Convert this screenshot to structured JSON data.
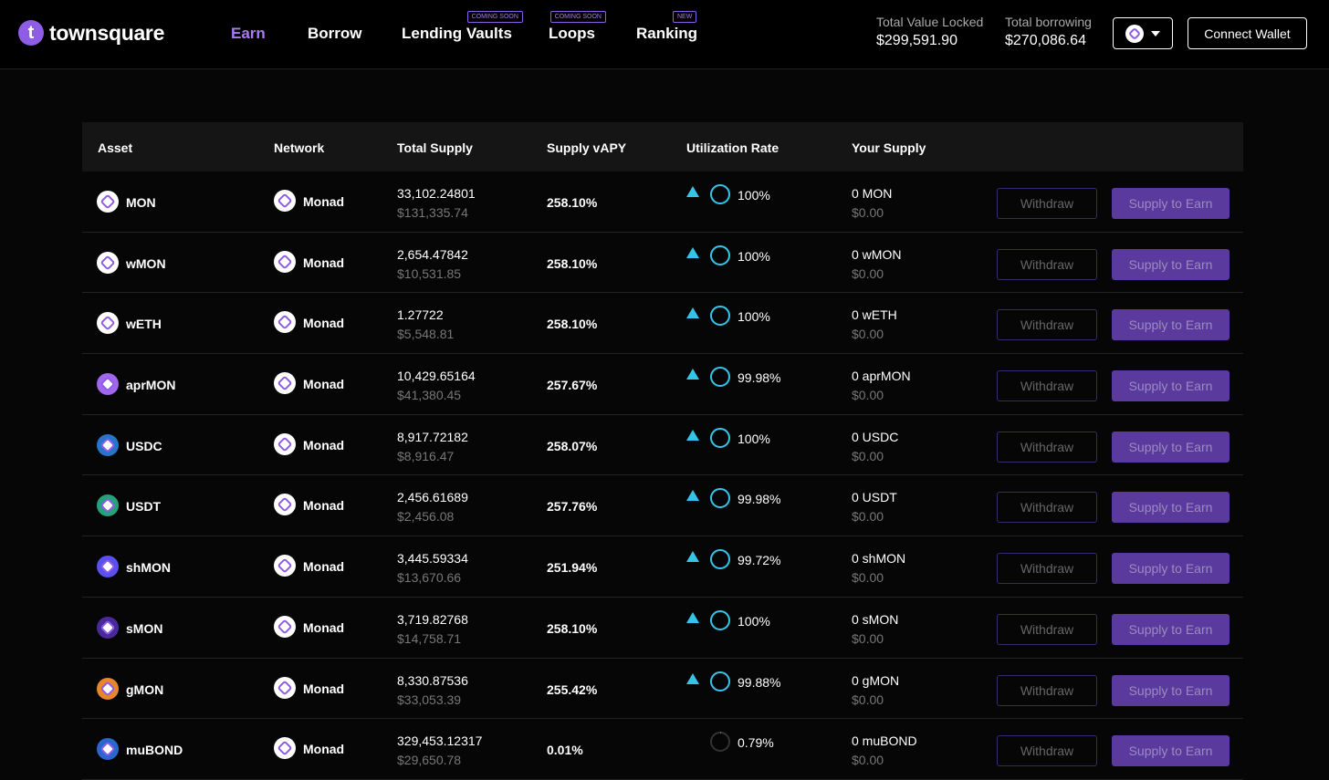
{
  "header": {
    "logo": "townsquare",
    "nav": [
      {
        "label": "Earn",
        "badge": null
      },
      {
        "label": "Borrow",
        "badge": null
      },
      {
        "label": "Lending Vaults",
        "badge": "COMING SOON"
      },
      {
        "label": "Loops",
        "badge": "COMING SOON"
      },
      {
        "label": "Ranking",
        "badge": "NEW"
      }
    ],
    "tvl_label": "Total Value Locked",
    "tvl": "$299,591.90",
    "borrow_label": "Total borrowing",
    "borrow": "$270,086.64",
    "connect": "Connect Wallet"
  },
  "table": {
    "columns": [
      "Asset",
      "Network",
      "Total Supply",
      "Supply vAPY",
      "Utilization Rate",
      "Your Supply"
    ],
    "withdraw_label": "Withdraw",
    "supply_label": "Supply to Earn",
    "rows": [
      {
        "asset": "MON",
        "icon_color": "#ffffff",
        "network": "Monad",
        "supply": "33,102.24801",
        "supply_usd": "$131,335.74",
        "apy": "258.10%",
        "util": "100%",
        "util_value": 100,
        "warn": true,
        "your": "0 MON",
        "your_usd": "$0.00"
      },
      {
        "asset": "wMON",
        "icon_color": "#ffffff",
        "network": "Monad",
        "supply": "2,654.47842",
        "supply_usd": "$10,531.85",
        "apy": "258.10%",
        "util": "100%",
        "util_value": 100,
        "warn": true,
        "your": "0 wMON",
        "your_usd": "$0.00"
      },
      {
        "asset": "wETH",
        "icon_color": "#ffffff",
        "network": "Monad",
        "supply": "1.27722",
        "supply_usd": "$5,548.81",
        "apy": "258.10%",
        "util": "100%",
        "util_value": 100,
        "warn": true,
        "your": "0 wETH",
        "your_usd": "$0.00"
      },
      {
        "asset": "aprMON",
        "icon_color": "#a066f0",
        "network": "Monad",
        "supply": "10,429.65164",
        "supply_usd": "$41,380.45",
        "apy": "257.67%",
        "util": "99.98%",
        "util_value": 99.98,
        "warn": true,
        "your": "0 aprMON",
        "your_usd": "$0.00"
      },
      {
        "asset": "USDC",
        "icon_color": "#2775ca",
        "network": "Monad",
        "supply": "8,917.72182",
        "supply_usd": "$8,916.47",
        "apy": "258.07%",
        "util": "100%",
        "util_value": 100,
        "warn": true,
        "your": "0 USDC",
        "your_usd": "$0.00"
      },
      {
        "asset": "USDT",
        "icon_color": "#26a17b",
        "network": "Monad",
        "supply": "2,456.61689",
        "supply_usd": "$2,456.08",
        "apy": "257.76%",
        "util": "99.98%",
        "util_value": 99.98,
        "warn": true,
        "your": "0 USDT",
        "your_usd": "$0.00"
      },
      {
        "asset": "shMON",
        "icon_color": "#5a4ff0",
        "network": "Monad",
        "supply": "3,445.59334",
        "supply_usd": "$13,670.66",
        "apy": "251.94%",
        "util": "99.72%",
        "util_value": 99.72,
        "warn": true,
        "your": "0 shMON",
        "your_usd": "$0.00"
      },
      {
        "asset": "sMON",
        "icon_color": "#4a2a9a",
        "network": "Monad",
        "supply": "3,719.82768",
        "supply_usd": "$14,758.71",
        "apy": "258.10%",
        "util": "100%",
        "util_value": 100,
        "warn": true,
        "your": "0 sMON",
        "your_usd": "$0.00"
      },
      {
        "asset": "gMON",
        "icon_color": "#e8862a",
        "network": "Monad",
        "supply": "8,330.87536",
        "supply_usd": "$33,053.39",
        "apy": "255.42%",
        "util": "99.88%",
        "util_value": 99.88,
        "warn": true,
        "your": "0 gMON",
        "your_usd": "$0.00"
      },
      {
        "asset": "muBOND",
        "icon_color": "#2a66d0",
        "network": "Monad",
        "supply": "329,453.12317",
        "supply_usd": "$29,650.78",
        "apy": "0.01%",
        "util": "0.79%",
        "util_value": 0.79,
        "warn": false,
        "your": "0 muBOND",
        "your_usd": "$0.00"
      }
    ]
  }
}
